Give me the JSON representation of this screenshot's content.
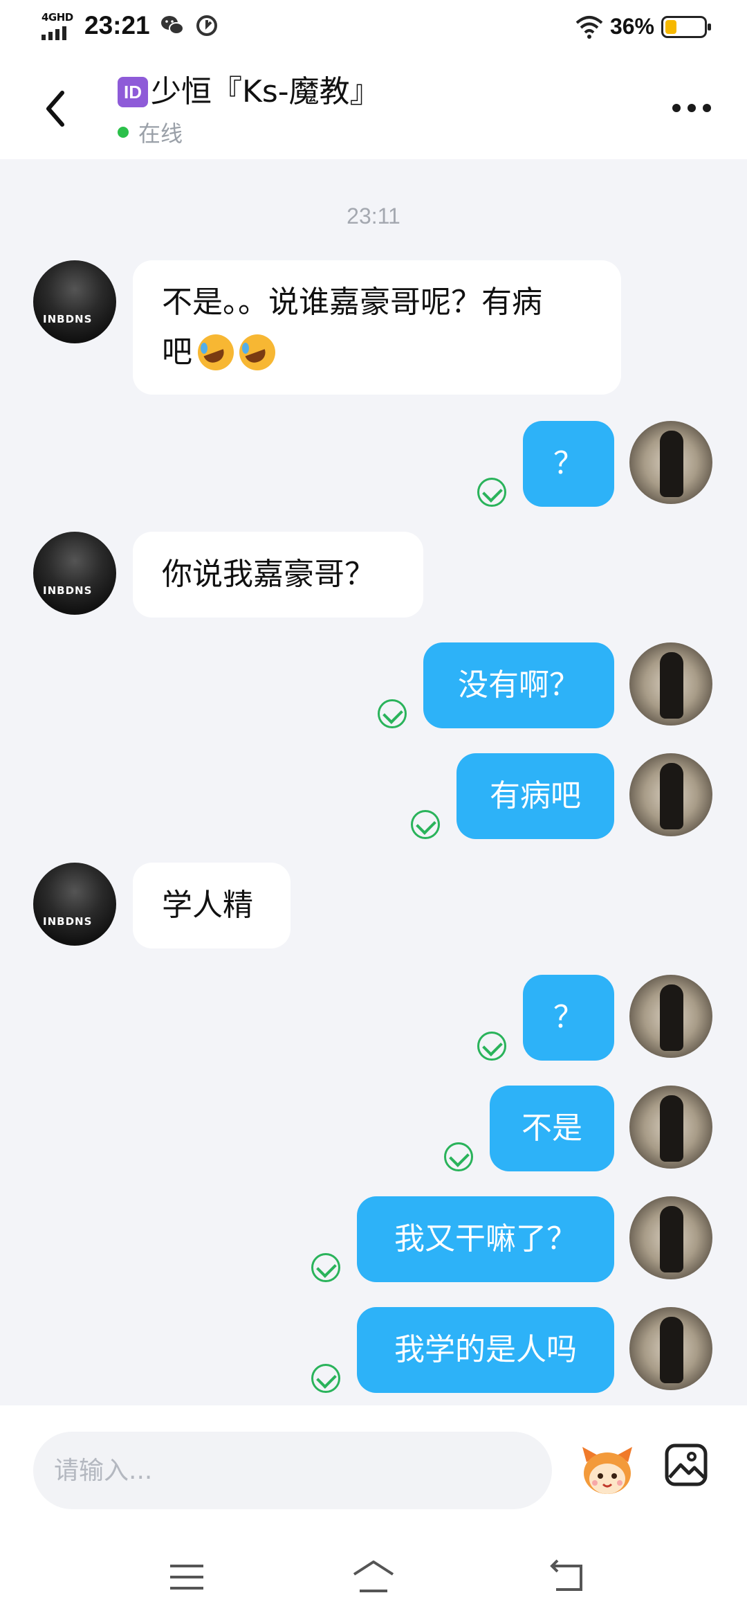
{
  "status_bar": {
    "network": "4GHD",
    "time": "23:21",
    "battery_percent": "36%",
    "battery_level": 0.36,
    "icons": [
      "wechat-icon",
      "sync-icon",
      "wifi-icon",
      "battery-icon"
    ]
  },
  "header": {
    "badge": "ID",
    "title": "少恒『Ks-魔教』",
    "status": "在线"
  },
  "chat": {
    "timestamp": "23:11",
    "messages": [
      {
        "side": "left",
        "text_line1": "不是。。说谁嘉豪哥呢？有病",
        "text_line2": "吧"
      },
      {
        "side": "right",
        "text": "？"
      },
      {
        "side": "left",
        "text": "你说我嘉豪哥？"
      },
      {
        "side": "right",
        "text": "没有啊？"
      },
      {
        "side": "right",
        "text": "有病吧"
      },
      {
        "side": "left",
        "text": "学人精"
      },
      {
        "side": "right",
        "text": "？"
      },
      {
        "side": "right",
        "text": "不是"
      },
      {
        "side": "right",
        "text": "我又干嘛了？"
      },
      {
        "side": "right",
        "text": "我学的是人吗"
      }
    ],
    "avatar_caption": "INBDNS"
  },
  "input": {
    "placeholder": "请输入..."
  },
  "colors": {
    "bubble_sent": "#2db2f8",
    "bubble_received": "#ffffff",
    "background": "#f3f4f8",
    "check": "#2ab35b",
    "online": "#2bc04a"
  }
}
